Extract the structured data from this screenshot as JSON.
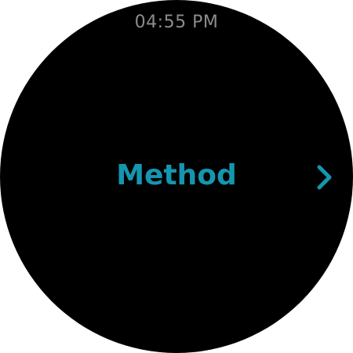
{
  "status_bar": {
    "time": "04:55 PM"
  },
  "main": {
    "title": "Method"
  },
  "navigation": {
    "next_icon": "chevron-right-icon"
  },
  "colors": {
    "background": "#000000",
    "accent": "#1596b0",
    "time_text": "#8c8c8c"
  }
}
